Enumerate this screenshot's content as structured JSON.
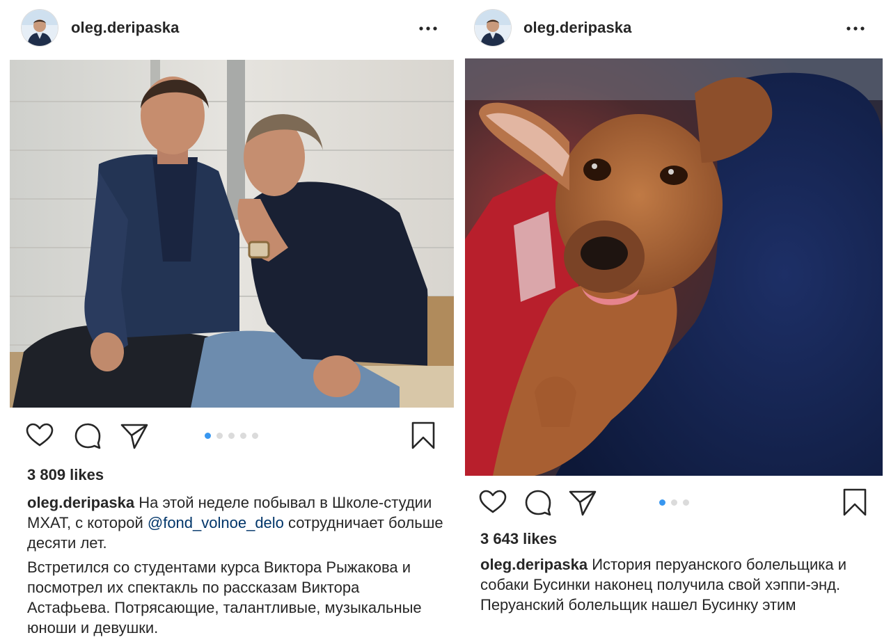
{
  "posts": [
    {
      "username": "oleg.deripaska",
      "likes": "3 809 likes",
      "carousel": {
        "count": 5,
        "active": 0
      },
      "caption": {
        "username": "oleg.deripaska",
        "text_before_mention": "На этой неделе побывал в Школе-студии МХАТ, с которой",
        "mention": "@fond_volnoe_delo",
        "text_after_mention": "сотрудничает больше десяти лет.",
        "paragraph2": "Встретился со студентами курса Виктора Рыжакова и посмотрел их спектакль по рассказам Виктора Астафьева. Потрясающие, талантливые, музыкальные юноши и девушки."
      }
    },
    {
      "username": "oleg.deripaska",
      "likes": "3 643 likes",
      "carousel": {
        "count": 3,
        "active": 0
      },
      "caption": {
        "username": "oleg.deripaska",
        "text": "История перуанского болельщика и собаки Бусинки наконец получила свой хэппи-энд. Перуанский болельщик  нашел Бусинку этим"
      }
    }
  ],
  "icons": {
    "like": "heart-icon",
    "comment": "comment-icon",
    "share": "paper-plane-icon",
    "save": "bookmark-icon",
    "more": "more-dots-icon"
  },
  "colors": {
    "text": "#262626",
    "mention": "#003569",
    "carousel_active": "#3897f0",
    "carousel_inactive": "#dbdbdb"
  }
}
